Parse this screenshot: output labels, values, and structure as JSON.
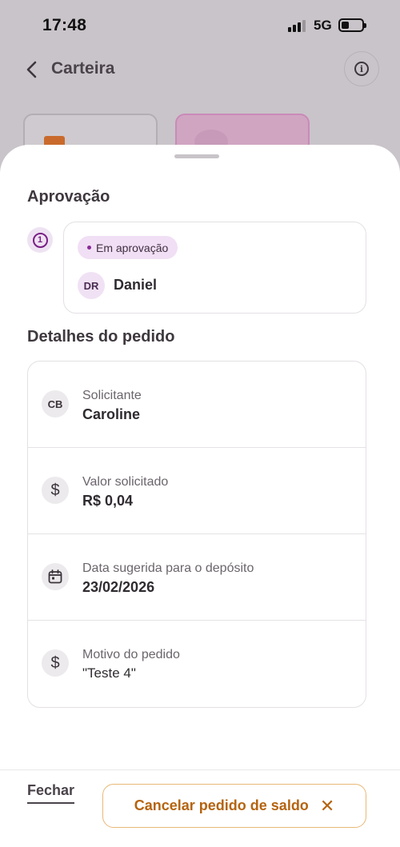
{
  "status_bar": {
    "time": "17:48",
    "network": "5G"
  },
  "header": {
    "title": "Carteira",
    "back_icon": "chevron-left-icon",
    "info_icon": "info-icon"
  },
  "approval": {
    "section_title": "Aprovação",
    "step_number": "1",
    "status_label": "Em aprovação",
    "approver_initials": "DR",
    "approver_name": "Daniel"
  },
  "details": {
    "section_title": "Detalhes do pedido",
    "rows": [
      {
        "icon": "initials-avatar",
        "icon_text": "CB",
        "label": "Solicitante",
        "value": "Caroline"
      },
      {
        "icon": "dollar-icon",
        "icon_text": "$",
        "label": "Valor solicitado",
        "value": "R$ 0,04"
      },
      {
        "icon": "calendar-icon",
        "icon_text": "",
        "label": "Data sugerida para o depósito",
        "value": "23/02/2026"
      },
      {
        "icon": "dollar-icon",
        "icon_text": "$",
        "label": "Motivo do pedido",
        "value": "\"Teste 4\""
      }
    ]
  },
  "footer": {
    "close_label": "Fechar",
    "cancel_label": "Cancelar pedido de saldo",
    "cancel_icon": "close-icon"
  },
  "colors": {
    "accent_purple": "#7a1f86",
    "chip_bg": "#f1dff5",
    "warning_orange": "#b56410",
    "button_border": "#e8b877"
  }
}
